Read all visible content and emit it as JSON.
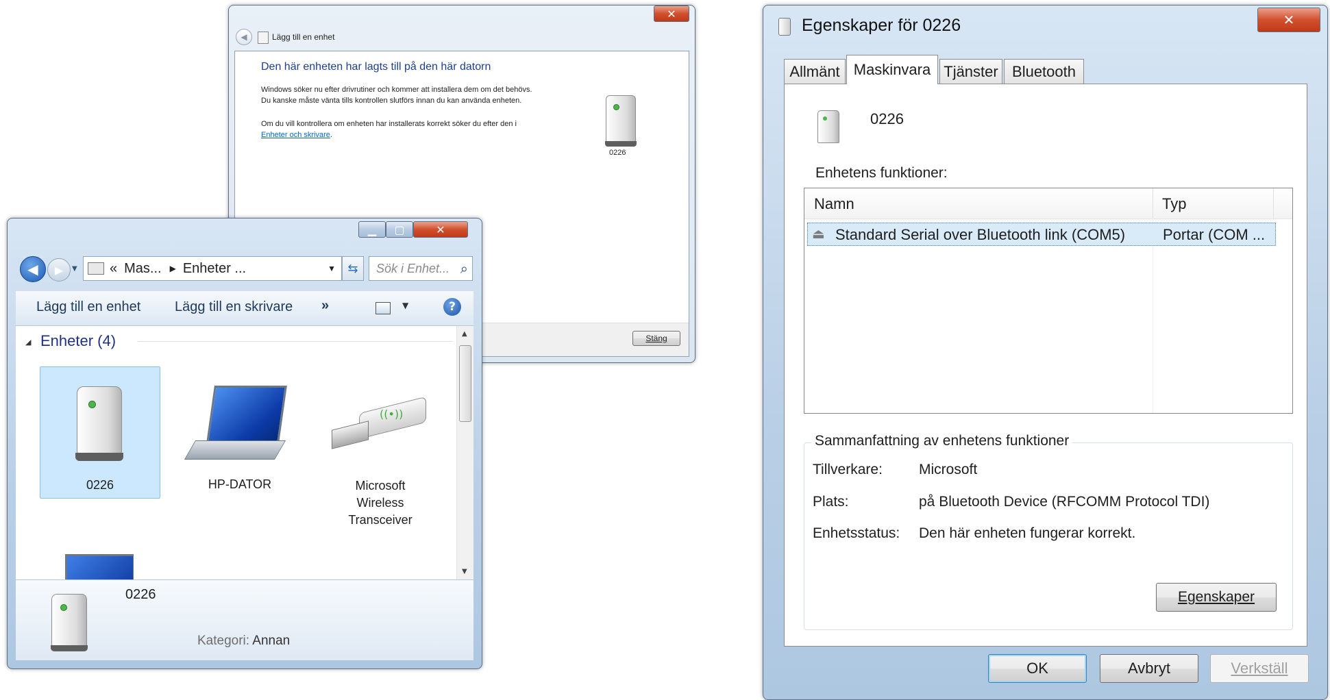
{
  "wizard": {
    "title": "Lägg till en enhet",
    "heading": "Den här enheten har lagts till på den här datorn",
    "para1": "Windows söker nu efter drivrutiner och kommer att installera dem om det behövs. Du kanske måste vänta tills kontrollen slutförs innan du kan använda enheten.",
    "para2_prefix": "Om du vill kontrollera om enheten har installerats korrekt söker du efter den i ",
    "para2_link": "Enheter och skrivare",
    "para2_suffix": ".",
    "device_label": "0226",
    "close_button": "Stäng"
  },
  "explorer": {
    "breadcrumb_prefix": "«",
    "breadcrumb_1": "Mas...",
    "breadcrumb_2": "Enheter ...",
    "search_placeholder": "Sök i Enhet...",
    "toolbar": {
      "add_device": "Lägg till en enhet",
      "add_printer": "Lägg till en skrivare",
      "more": "»"
    },
    "group_header": "Enheter (4)",
    "devices": [
      {
        "label": "0226",
        "icon": "speaker-device-icon"
      },
      {
        "label": "HP-DATOR",
        "icon": "laptop-icon"
      },
      {
        "label": "Microsoft Wireless Transceiver",
        "icon": "usb-transceiver-icon"
      }
    ],
    "details": {
      "name": "0226",
      "category_label": "Kategori:",
      "category_value": "Annan"
    }
  },
  "props": {
    "title": "Egenskaper för 0226",
    "tabs": [
      "Allmänt",
      "Maskinvara",
      "Tjänster",
      "Bluetooth"
    ],
    "active_tab": "Maskinvara",
    "device_name": "0226",
    "functions_label": "Enhetens funktioner:",
    "columns": [
      "Namn",
      "Typ"
    ],
    "rows": [
      {
        "name": "Standard Serial over Bluetooth link (COM5)",
        "type": "Portar (COM ..."
      }
    ],
    "summary_title": "Sammanfattning av enhetens funktioner",
    "summary": [
      {
        "label": "Tillverkare:",
        "value": "Microsoft"
      },
      {
        "label": "Plats:",
        "value": "på Bluetooth Device (RFCOMM Protocol TDI)"
      },
      {
        "label": "Enhetsstatus:",
        "value": "Den här enheten fungerar korrekt."
      }
    ],
    "properties_button": "Egenskaper",
    "ok_button": "OK",
    "cancel_button": "Avbryt",
    "apply_button": "Verkställ"
  }
}
